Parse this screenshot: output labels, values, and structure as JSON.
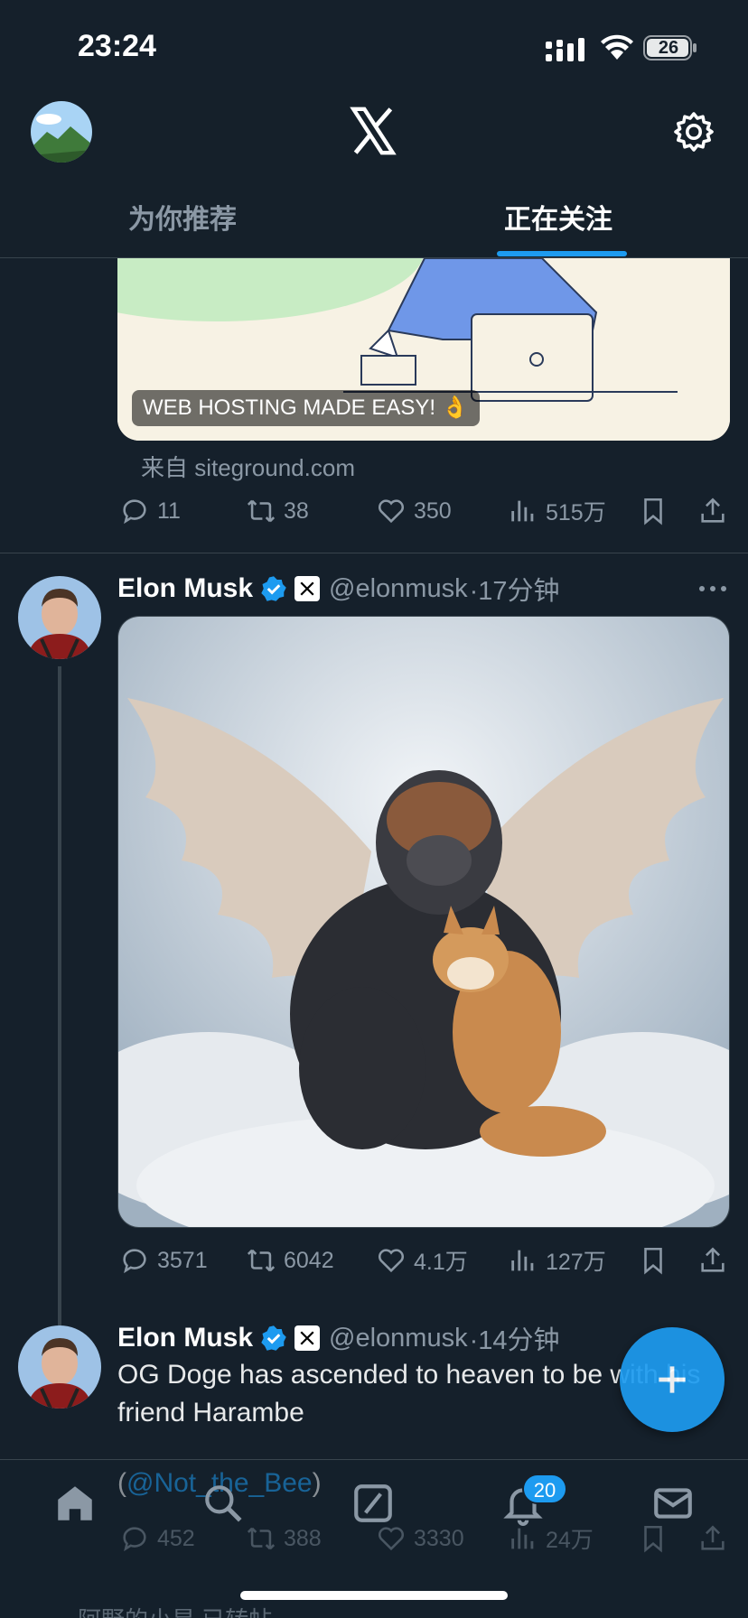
{
  "status_bar": {
    "time": "23:24",
    "battery": "26"
  },
  "header": {
    "tabs": [
      {
        "label": "为你推荐",
        "active": false
      },
      {
        "label": "正在关注",
        "active": true
      }
    ]
  },
  "ad": {
    "caption": "WEB HOSTING MADE EASY! 👌",
    "source": "来自 siteground.com",
    "stats": {
      "replies": "11",
      "reposts": "38",
      "likes": "350",
      "views": "515万"
    }
  },
  "tweets": [
    {
      "name": "Elon Musk",
      "handle": "@elonmusk",
      "time": "·17分钟",
      "stats": {
        "replies": "3571",
        "reposts": "6042",
        "likes": "4.1万",
        "views": "127万"
      }
    },
    {
      "name": "Elon Musk",
      "handle": "@elonmusk",
      "time": "·14分钟",
      "text": "OG Doge has ascended to heaven to be with his friend Harambe",
      "link_open": "(",
      "link": "@Not_the_Bee",
      "link_close": ")",
      "stats": {
        "replies": "452",
        "reposts": "388",
        "likes": "3330",
        "views": "24万"
      }
    }
  ],
  "bottom_nav": {
    "notifications_count": "20"
  },
  "peek_text": "阿野的小星 已转帖",
  "colors": {
    "background": "#15202b",
    "accent": "#1d9bf0",
    "muted": "#8b98a5",
    "border": "#38444d"
  }
}
